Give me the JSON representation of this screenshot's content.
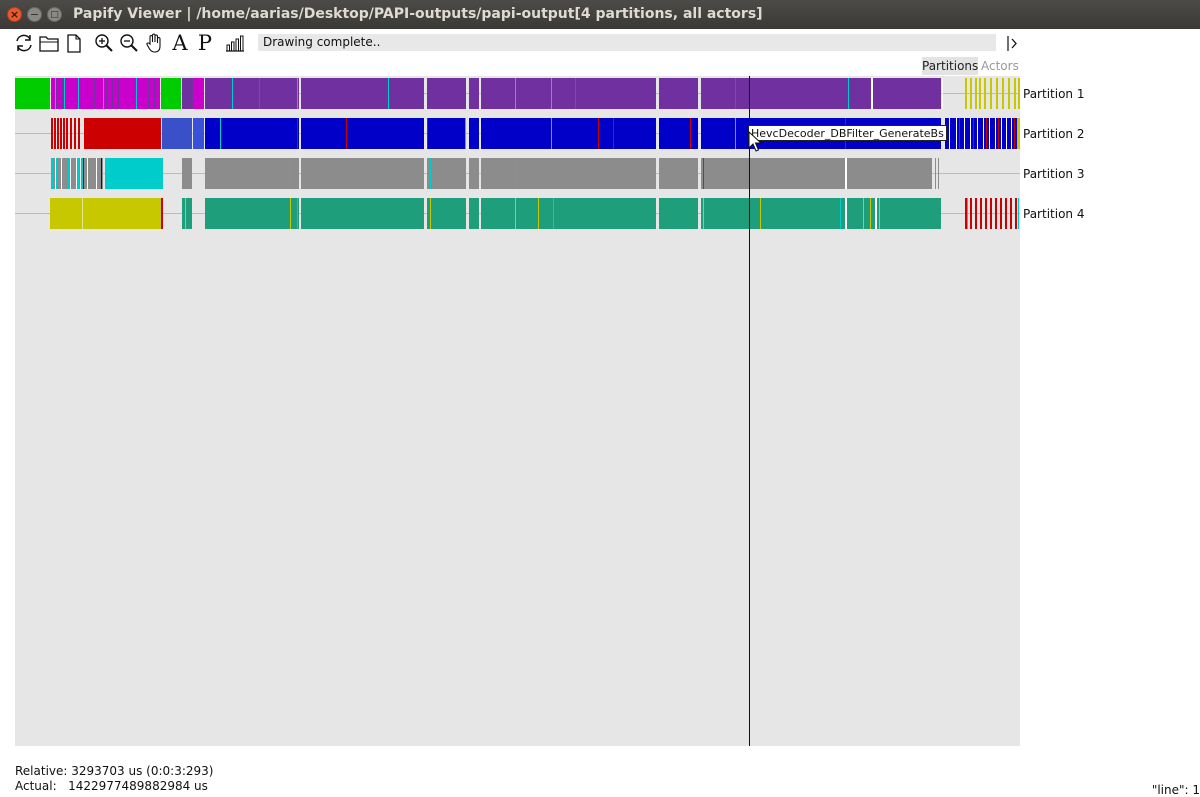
{
  "window": {
    "title": "Papify Viewer | /home/aarias/Desktop/PAPI-outputs/papi-output[4 partitions, all actors]",
    "close_glyph": "×",
    "minimize_glyph": "−",
    "maximize_glyph": "□"
  },
  "toolbar": {
    "icons": [
      "refresh-icon",
      "open-folder-icon",
      "new-file-icon",
      "zoom-in-icon",
      "zoom-out-icon",
      "hand-pan-icon",
      "actors-toggle-icon",
      "partitions-toggle-icon",
      "statistics-icon"
    ],
    "actors_letter": "A",
    "partitions_letter": "P",
    "status": "Drawing complete..",
    "collapse_glyph": "|›"
  },
  "tabs": {
    "partitions": "Partitions",
    "actors": "Actors",
    "active": "Partitions"
  },
  "colors": {
    "canvas_bg": "#e6e6e6",
    "partition_1": "#7030a0",
    "partition_2": "#0000c8",
    "partition_3": "#8c8c8c",
    "partition_4": "#1f9e7c",
    "green": "#00cc00",
    "magenta": "#cc00cc",
    "red": "#cc0000",
    "cyan": "#00cccc",
    "yellow": "#c8c800"
  },
  "rows": [
    {
      "label": "Partition 1"
    },
    {
      "label": "Partition 2"
    },
    {
      "label": "Partition 3"
    },
    {
      "label": "Partition 4"
    }
  ],
  "tooltip": "HevcDecoder_DBFilter_GenerateBs",
  "footer": {
    "relative": "Relative: 3293703 us (0:0:3:293)",
    "actual": "Actual:   1422977489882984 us",
    "corner": "\"line\": 1"
  }
}
